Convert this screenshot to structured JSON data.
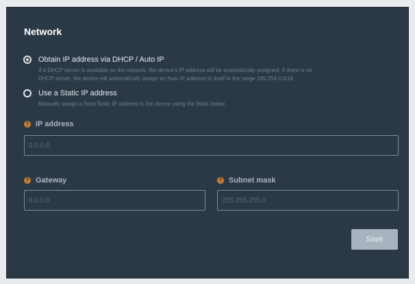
{
  "network": {
    "title": "Network",
    "dhcp_option": {
      "label": "Obtain IP address via DHCP / Auto IP",
      "help_line1": "If a DHCP server is available on the network, the device's IP address will be automatically assigned. If there is no",
      "help_line2": "DHCP server, the device will automatically assign an Auto IP address to itself in the range 169.254.0.0/16",
      "selected": true
    },
    "static_option": {
      "label": "Use a Static IP address",
      "help": "Manually assign a fixed Static IP address to the device using the fields below.",
      "selected": false
    },
    "ip_address": {
      "label": "IP address",
      "help_icon": "question-mark",
      "placeholder": "0.0.0.0",
      "value": ""
    },
    "gateway": {
      "label": "Gateway",
      "help_icon": "question-mark",
      "placeholder": "0.0.0.0",
      "value": ""
    },
    "subnet_mask": {
      "label": "Subnet mask",
      "help_icon": "question-mark",
      "placeholder": "255.255.255.0",
      "value": ""
    },
    "save_label": "Save"
  },
  "colors": {
    "panel_background": "#2b3947",
    "help_icon": "#c97b30",
    "save_button": "#a7b3bf"
  }
}
